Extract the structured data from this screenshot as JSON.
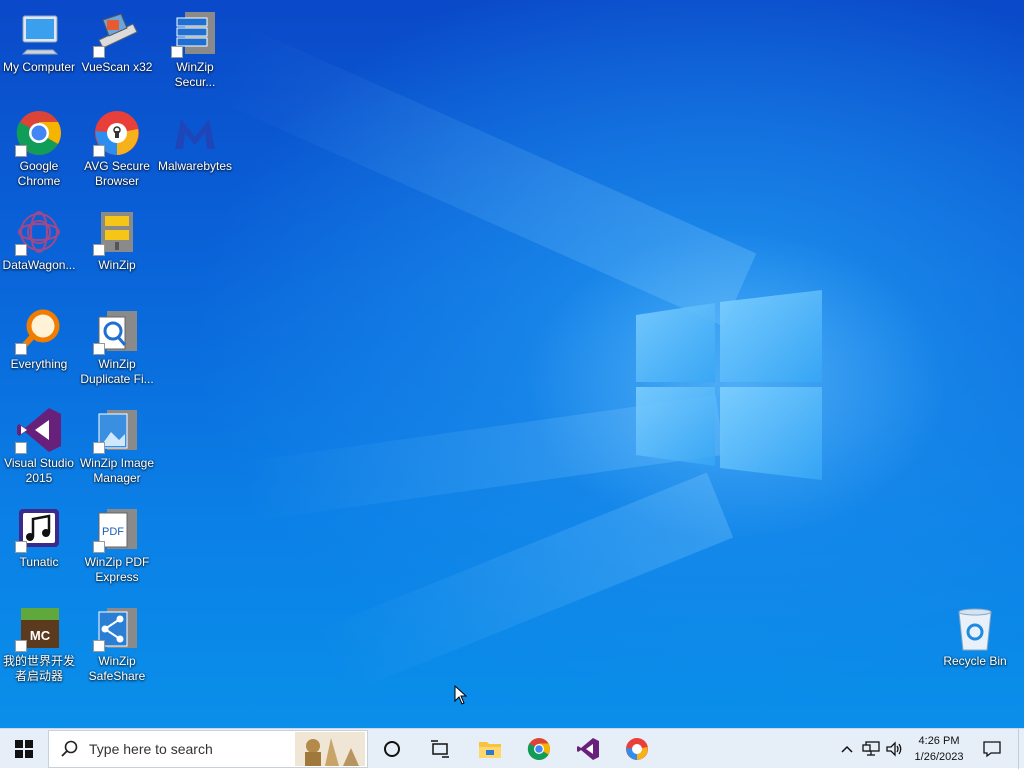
{
  "desktop": {
    "icons": [
      {
        "label": "My Computer",
        "icon": "monitor-icon"
      },
      {
        "label": "VueScan x32",
        "icon": "scanner-icon"
      },
      {
        "label": "WinZip Secur...",
        "icon": "winzip-secure-icon"
      },
      {
        "label": "Google Chrome",
        "icon": "chrome-icon"
      },
      {
        "label": "AVG Secure Browser",
        "icon": "avg-browser-icon"
      },
      {
        "label": "Malwarebytes",
        "icon": "malwarebytes-icon"
      },
      {
        "label": "DataWagon...",
        "icon": "datawagon-icon"
      },
      {
        "label": "WinZip",
        "icon": "winzip-icon"
      },
      {
        "label": "Everything",
        "icon": "everything-search-icon"
      },
      {
        "label": "WinZip Duplicate Fi...",
        "icon": "winzip-duplicate-icon"
      },
      {
        "label": "Visual Studio 2015",
        "icon": "visual-studio-icon"
      },
      {
        "label": "WinZip Image Manager",
        "icon": "winzip-image-icon"
      },
      {
        "label": "Tunatic",
        "icon": "tunatic-icon"
      },
      {
        "label": "WinZip PDF Express",
        "icon": "winzip-pdf-icon"
      },
      {
        "label": "我的世界开发者启动器",
        "icon": "minecraft-launcher-icon"
      },
      {
        "label": "WinZip SafeShare",
        "icon": "winzip-safeshare-icon"
      },
      {
        "label": "Recycle Bin",
        "icon": "recycle-bin-icon"
      }
    ]
  },
  "taskbar": {
    "search_placeholder": "Type here to search",
    "pinned": [
      "start-icon",
      "cortana-icon",
      "task-view-icon",
      "file-explorer-icon",
      "chrome-icon",
      "visual-studio-icon",
      "avg-browser-icon"
    ],
    "clock_time": "4:26 PM",
    "clock_date": "1/26/2023"
  },
  "colors": {
    "accent": "#0a63d8",
    "taskbar": "#e6eef8"
  }
}
